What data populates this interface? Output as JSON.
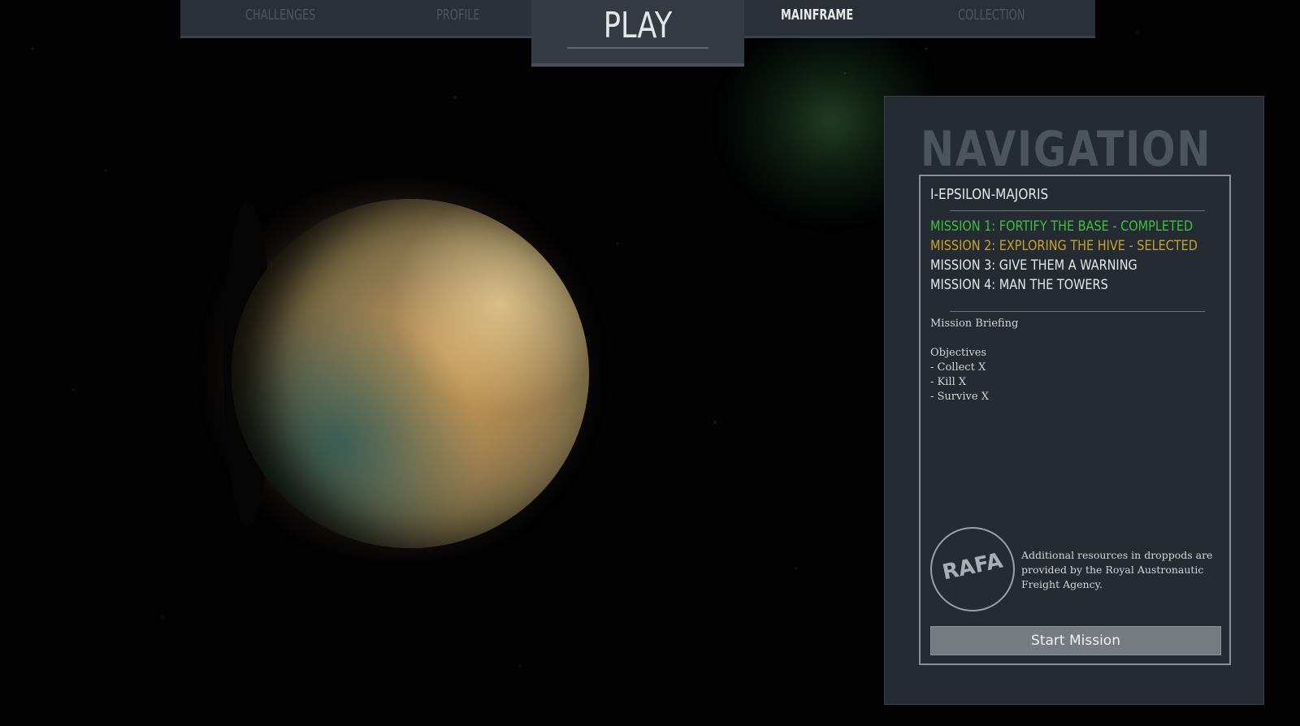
{
  "nav": {
    "challenges": "CHALLENGES",
    "profile": "PROFILE",
    "play": "PLAY",
    "mainframe": "MAINFRAME",
    "collection": "COLLECTION"
  },
  "panel": {
    "title": "NAVIGATION",
    "system": "I-EPSILON-MAJORIS",
    "missions": [
      {
        "label": "MISSION 1: FORTIFY THE BASE - COMPLETED",
        "status": "completed"
      },
      {
        "label": "MISSION 2: EXPLORING THE HIVE - SELECTED",
        "status": "selected"
      },
      {
        "label": "MISSION 3: GIVE THEM A WARNING",
        "status": "normal"
      },
      {
        "label": "MISSION 4: MAN THE TOWERS",
        "status": "normal"
      }
    ],
    "briefing_label": "Mission Briefing",
    "objectives_label": "Objectives",
    "objectives": [
      "- Collect X",
      "- Kill X",
      "- Survive X"
    ],
    "rafa_logo": "RAFA",
    "rafa_info": "Additional resources in droppods are provided by the Royal Austronautic Freight Agency.",
    "start_button": "Start Mission"
  },
  "colors": {
    "completed": "#3fbf3f",
    "selected": "#c9a227",
    "normal": "#e6e6e6"
  }
}
